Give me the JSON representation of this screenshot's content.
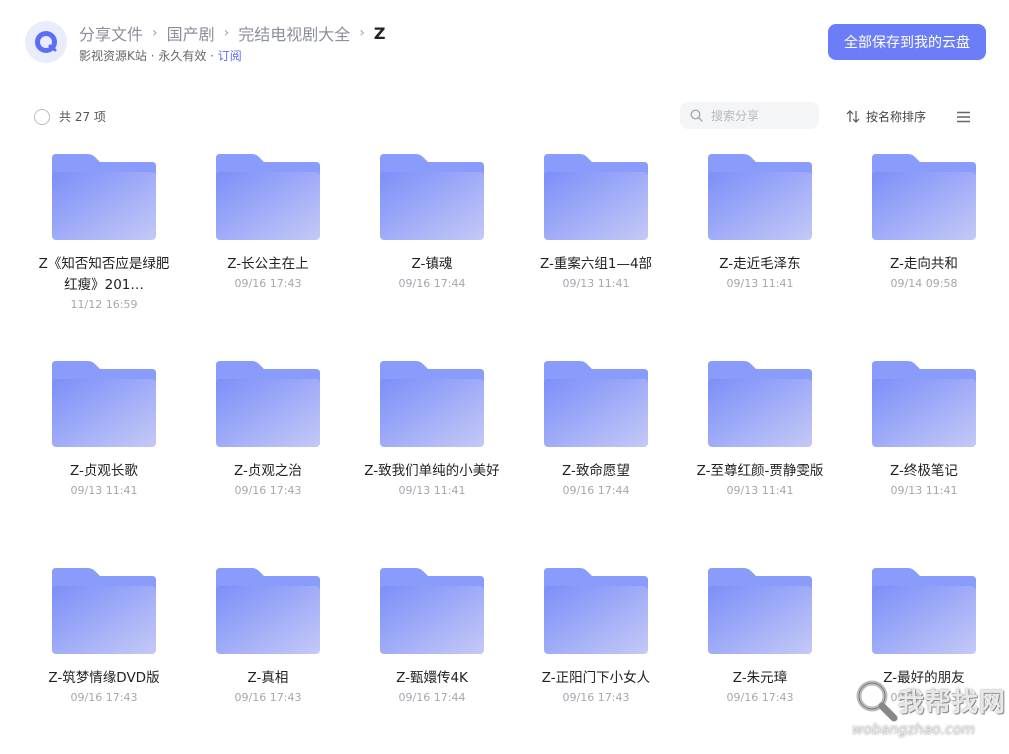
{
  "header": {
    "breadcrumb": [
      "分享文件",
      "国产剧",
      "完结电视剧大全",
      "Z"
    ],
    "subtitle_prefix": "影视资源K站 · 永久有效 · ",
    "subscribe_link": "订阅",
    "save_button": "全部保存到我的云盘"
  },
  "toolbar": {
    "count_label": "共 27 项",
    "search_placeholder": "搜索分享",
    "sort_label": "按名称排序"
  },
  "files": [
    {
      "name": "Z《知否知否应是绿肥红瘦》201…",
      "date": "11/12 16:59"
    },
    {
      "name": "Z-长公主在上",
      "date": "09/16 17:43"
    },
    {
      "name": "Z-镇魂",
      "date": "09/16 17:44"
    },
    {
      "name": "Z-重案六组1—4部",
      "date": "09/13 11:41"
    },
    {
      "name": "Z-走近毛泽东",
      "date": "09/13 11:41"
    },
    {
      "name": "Z-走向共和",
      "date": "09/14 09:58"
    },
    {
      "name": "Z-贞观长歌",
      "date": "09/13 11:41"
    },
    {
      "name": "Z-贞观之治",
      "date": "09/16 17:43"
    },
    {
      "name": "Z-致我们单纯的小美好",
      "date": "09/13 11:41"
    },
    {
      "name": "Z-致命愿望",
      "date": "09/16 17:44"
    },
    {
      "name": "Z-至尊红颜-贾静雯版",
      "date": "09/13 11:41"
    },
    {
      "name": "Z-终极笔记",
      "date": "09/13 11:41"
    },
    {
      "name": "Z-筑梦情缘DVD版",
      "date": "09/16 17:43"
    },
    {
      "name": "Z-真相",
      "date": "09/16 17:43"
    },
    {
      "name": "Z-甄嬛传4K",
      "date": "09/16 17:44"
    },
    {
      "name": "Z-正阳门下小女人",
      "date": "09/16 17:43"
    },
    {
      "name": "Z-朱元璋",
      "date": "09/16 17:43"
    },
    {
      "name": "Z-最好的朋友",
      "date": "09/16 17:43"
    }
  ],
  "watermark": {
    "text": "我帮找网",
    "url": "wobangzhao.com"
  },
  "colors": {
    "accent": "#6b7ef7",
    "folder_top": "#8a9cfb",
    "folder_body": "#7b8ff8",
    "link": "#5b6ef5"
  }
}
